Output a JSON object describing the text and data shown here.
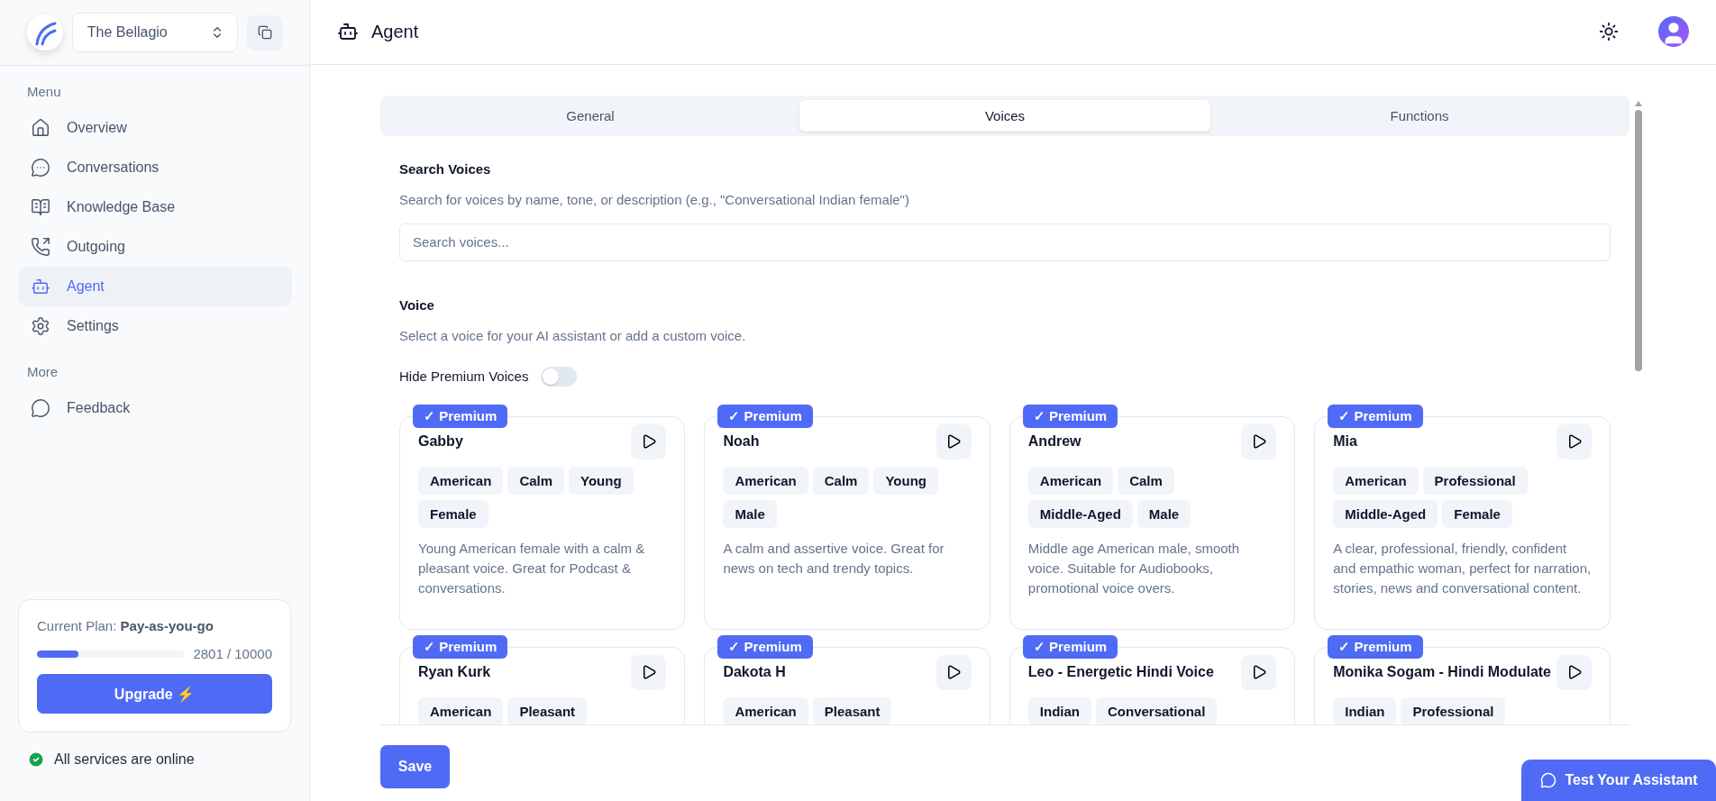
{
  "sidebar": {
    "workspace": "The Bellagio",
    "sections": [
      {
        "heading": "Menu",
        "items": [
          {
            "label": "Overview",
            "selected": false
          },
          {
            "label": "Conversations",
            "selected": false
          },
          {
            "label": "Knowledge Base",
            "selected": false
          },
          {
            "label": "Outgoing",
            "selected": false
          },
          {
            "label": "Agent",
            "selected": true
          },
          {
            "label": "Settings",
            "selected": false
          }
        ]
      },
      {
        "heading": "More",
        "items": [
          {
            "label": "Feedback",
            "selected": false
          }
        ]
      }
    ],
    "plan": {
      "label": "Current Plan: **Pay-as-you-go**",
      "level": 0.28,
      "usage": "2801 / 10000",
      "button": "Upgrade ⚡"
    },
    "status": "All services are online"
  },
  "header": {
    "title": "Agent"
  },
  "tabs": [
    {
      "label": "General",
      "selected": false
    },
    {
      "label": "Voices",
      "selected": true
    },
    {
      "label": "Functions",
      "selected": false
    }
  ],
  "search": {
    "heading": "Search Voices",
    "description": "Search for voices by name, tone, or description (e.g., \"Conversational Indian female\")",
    "placeholder": "Search voices..."
  },
  "voice": {
    "heading": "Voice",
    "description": "Select a voice for your AI assistant or add a custom voice.",
    "toggle": {
      "label": "Hide Premium Voices",
      "on": false
    }
  },
  "voices": [
    {
      "badge": "✓ Premium",
      "name": "Gabby",
      "tags": [
        "American",
        "Calm",
        "Young",
        "Female"
      ],
      "description": "Young American female with a calm & pleasant voice. Great for Podcast & conversations."
    },
    {
      "badge": "✓ Premium",
      "name": "Noah",
      "tags": [
        "American",
        "Calm",
        "Young",
        "Male"
      ],
      "description": "A calm and assertive voice. Great for news on tech and trendy topics."
    },
    {
      "badge": "✓ Premium",
      "name": "Andrew",
      "tags": [
        "American",
        "Calm",
        "Middle-Aged",
        "Male"
      ],
      "description": "Middle age American male, smooth voice. Suitable for Audiobooks, promotional voice overs."
    },
    {
      "badge": "✓ Premium",
      "name": "Mia",
      "tags": [
        "American",
        "Professional",
        "Middle-Aged",
        "Female"
      ],
      "description": "A clear, professional, friendly, confident and empathic woman, perfect for narration, stories, news and conversational content."
    },
    {
      "badge": "✓ Premium",
      "name": "Ryan Kurk",
      "tags": [
        "American",
        "Pleasant"
      ]
    },
    {
      "badge": "✓ Premium",
      "name": "Dakota H",
      "tags": [
        "American",
        "Pleasant"
      ]
    },
    {
      "badge": "✓ Premium",
      "name": "Leo - Energetic Hindi Voice",
      "tags": [
        "Indian",
        "Conversational"
      ]
    },
    {
      "badge": "✓ Premium",
      "name": "Monika Sogam - Hindi Modulate",
      "tags": [
        "Indian",
        "Professional"
      ]
    }
  ],
  "save": "Save",
  "assistant_button": "Test Your Assistant"
}
